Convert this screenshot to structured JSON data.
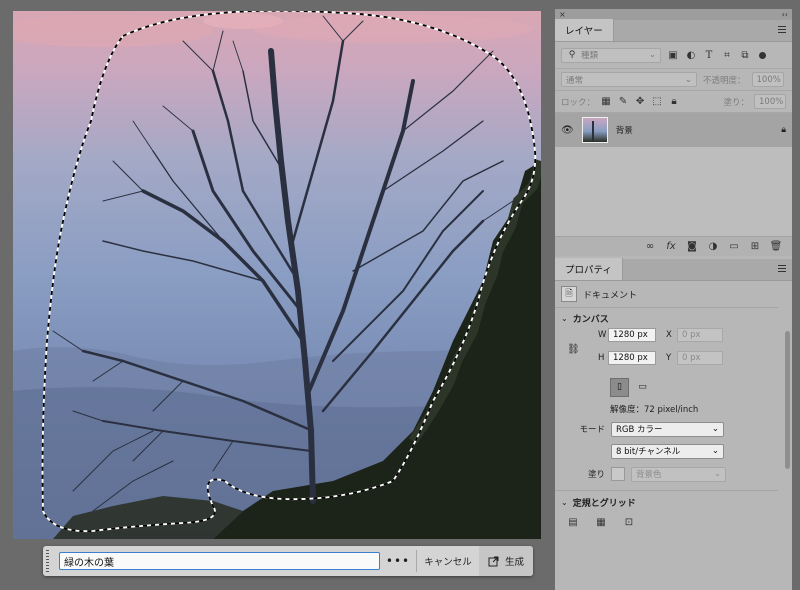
{
  "canvas": {
    "selection": "marching-ants"
  },
  "task_bar": {
    "prompt_value": "緑の木の葉",
    "more_label": "•••",
    "cancel_label": "キャンセル",
    "generate_label": "生成"
  },
  "panel_header": {
    "close_glyph": "×",
    "collapse_glyph": "‹‹"
  },
  "layers_panel": {
    "tab_label": "レイヤー",
    "filter_placeholder": "種類",
    "blend_mode": "通常",
    "opacity_label": "不透明度：",
    "opacity_value": "100%",
    "lock_label": "ロック：",
    "fill_label": "塗り：",
    "fill_value": "100%",
    "layers": [
      {
        "name": "背景",
        "visible": true,
        "locked": true
      }
    ]
  },
  "properties_panel": {
    "tab_label": "プロパティ",
    "document_label": "ドキュメント",
    "canvas_section": "カンバス",
    "w_label": "W",
    "w_value": "1280 px",
    "x_label": "X",
    "x_value": "0 px",
    "h_label": "H",
    "h_value": "1280 px",
    "y_label": "Y",
    "y_value": "0 px",
    "resolution": "解像度：72 pixel/inch",
    "mode_label": "モード",
    "mode_value": "RGB カラー",
    "bit_value": "8 bit/チャンネル",
    "fill_label": "塗り",
    "fill_value": "背景色",
    "rulers_section": "定規とグリッド"
  },
  "colors": {
    "selection_accent": "#3a7fd0",
    "panel_bg": "#b7b7b7",
    "app_bg": "#6b6b6b"
  }
}
